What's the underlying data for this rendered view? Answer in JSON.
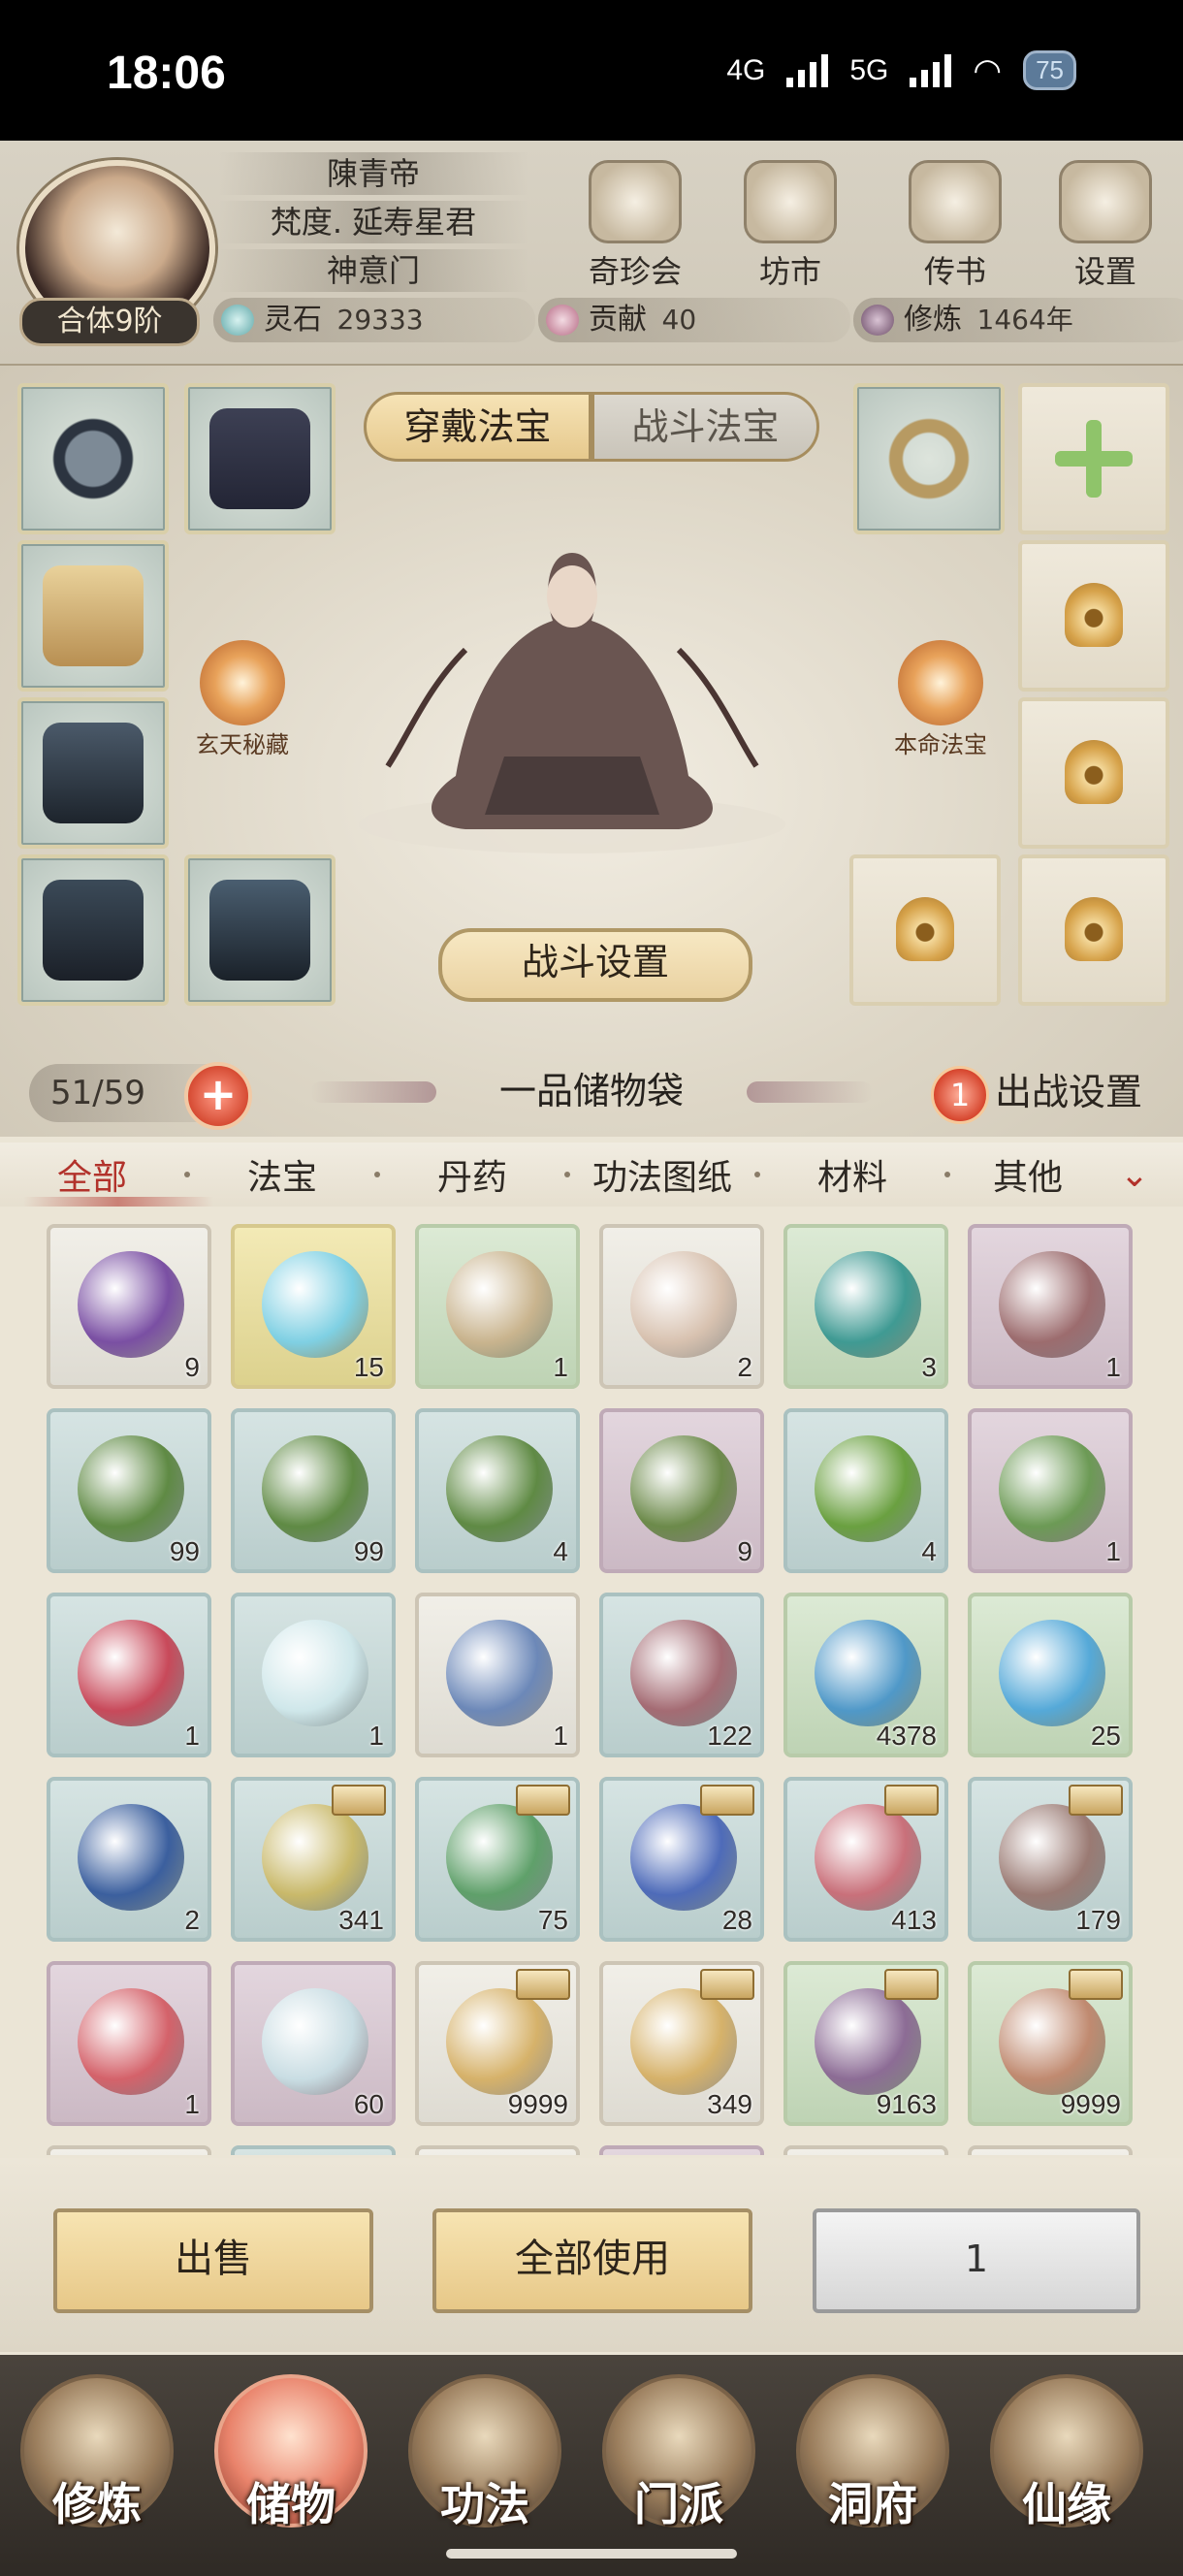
{
  "status_bar": {
    "time": "18:06",
    "net1": "4G",
    "net2": "5G",
    "battery": "75"
  },
  "player": {
    "name": "陳青帝",
    "title": "梵度. 延寿星君",
    "sect": "神意门",
    "realm": "合体9阶"
  },
  "top_menu": [
    {
      "label": "奇珍会",
      "icon": "treasure-pavilion-icon"
    },
    {
      "label": "坊市",
      "icon": "market-icon"
    },
    {
      "label": "传书",
      "icon": "letter-icon"
    },
    {
      "label": "设置",
      "icon": "gear-icon"
    }
  ],
  "resources": {
    "spirit_stone": {
      "label": "灵石",
      "value": "29333"
    },
    "contribution": {
      "label": "贡献",
      "value": "40"
    },
    "cultivation": {
      "label": "修炼",
      "value": "1464年"
    }
  },
  "equip_tabs": {
    "wear": "穿戴法宝",
    "battle": "战斗法宝"
  },
  "equip_labels": {
    "left_orb": "玄天秘藏",
    "right_orb": "本命法宝",
    "battle_settings": "战斗设置"
  },
  "bag": {
    "capacity": "51/59",
    "expand": "+",
    "name": "一品储物袋",
    "deploy_count": "1",
    "deploy_label": "出战设置"
  },
  "categories": [
    "全部",
    "法宝",
    "丹药",
    "功法图纸",
    "材料",
    "其他"
  ],
  "items": [
    {
      "rarity": "white",
      "qty": "9",
      "color": "#7a4fa3",
      "boxed": false
    },
    {
      "rarity": "yellow",
      "qty": "15",
      "color": "#7fd0e3",
      "boxed": false
    },
    {
      "rarity": "green",
      "qty": "1",
      "color": "#c9b48e",
      "boxed": false
    },
    {
      "rarity": "white",
      "qty": "2",
      "color": "#d8c2b0",
      "boxed": false
    },
    {
      "rarity": "green",
      "qty": "3",
      "color": "#3f9a93",
      "boxed": false
    },
    {
      "rarity": "purple",
      "qty": "1",
      "color": "#9c6c6e",
      "boxed": false
    },
    {
      "rarity": "blue",
      "qty": "99",
      "color": "#5f8a44",
      "boxed": false
    },
    {
      "rarity": "blue",
      "qty": "99",
      "color": "#5f8a44",
      "boxed": false
    },
    {
      "rarity": "blue",
      "qty": "4",
      "color": "#5f8a44",
      "boxed": false
    },
    {
      "rarity": "purple",
      "qty": "9",
      "color": "#6c8a4a",
      "boxed": false
    },
    {
      "rarity": "blue",
      "qty": "4",
      "color": "#6aa040",
      "boxed": false
    },
    {
      "rarity": "purple",
      "qty": "1",
      "color": "#6c9a55",
      "boxed": false
    },
    {
      "rarity": "blue",
      "qty": "1",
      "color": "#c8495a",
      "boxed": false
    },
    {
      "rarity": "blue",
      "qty": "1",
      "color": "#cfe7ea",
      "boxed": false
    },
    {
      "rarity": "white",
      "qty": "1",
      "color": "#6c88b8",
      "boxed": false
    },
    {
      "rarity": "blue",
      "qty": "122",
      "color": "#a46b73",
      "boxed": false
    },
    {
      "rarity": "green",
      "qty": "4378",
      "color": "#4f98c8",
      "boxed": false
    },
    {
      "rarity": "green",
      "qty": "25",
      "color": "#55a9d8",
      "boxed": false
    },
    {
      "rarity": "blue",
      "qty": "2",
      "color": "#3b5f9e",
      "boxed": false
    },
    {
      "rarity": "blue",
      "qty": "341",
      "color": "#c9b96a",
      "boxed": true
    },
    {
      "rarity": "blue",
      "qty": "75",
      "color": "#5fa06a",
      "boxed": true
    },
    {
      "rarity": "blue",
      "qty": "28",
      "color": "#4e6bb9",
      "boxed": true
    },
    {
      "rarity": "blue",
      "qty": "413",
      "color": "#c9707a",
      "boxed": true
    },
    {
      "rarity": "blue",
      "qty": "179",
      "color": "#9a7a73",
      "boxed": true
    },
    {
      "rarity": "purple",
      "qty": "1",
      "color": "#d4626a",
      "boxed": false
    },
    {
      "rarity": "purple",
      "qty": "60",
      "color": "#c9dde3",
      "boxed": false
    },
    {
      "rarity": "white",
      "qty": "9999",
      "color": "#d6b26a",
      "boxed": true
    },
    {
      "rarity": "white",
      "qty": "349",
      "color": "#d6b26a",
      "boxed": true
    },
    {
      "rarity": "green",
      "qty": "9163",
      "color": "#8c6c95",
      "boxed": true
    },
    {
      "rarity": "green",
      "qty": "9999",
      "color": "#c08a70",
      "boxed": true
    }
  ],
  "actions": {
    "sell": "出售",
    "use_all": "全部使用",
    "quantity": "1"
  },
  "nav": [
    {
      "label": "修炼",
      "active": false
    },
    {
      "label": "储物",
      "active": true
    },
    {
      "label": "功法",
      "active": false
    },
    {
      "label": "门派",
      "active": false
    },
    {
      "label": "洞府",
      "active": false
    },
    {
      "label": "仙缘",
      "active": false
    }
  ]
}
